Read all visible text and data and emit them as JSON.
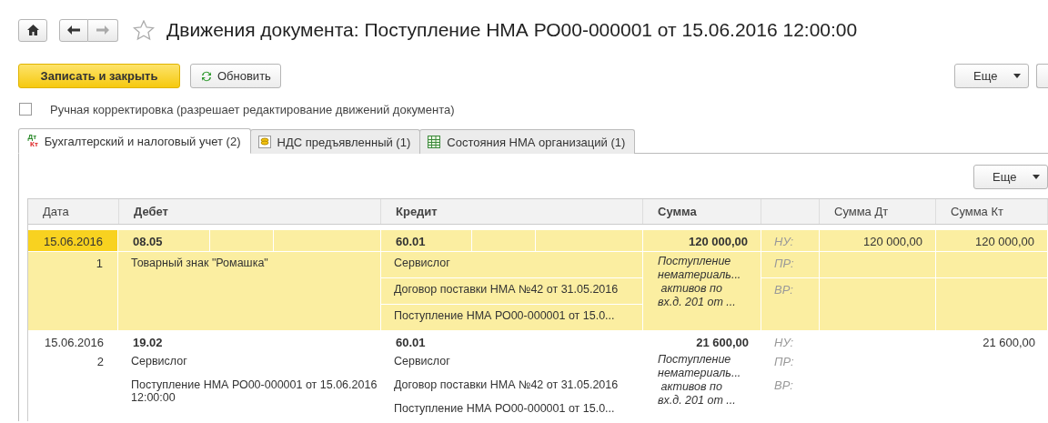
{
  "window": {
    "title": "Движения документа: Поступление НМА РО00-000001 от 15.06.2016 12:00:00",
    "favorite": false,
    "forward_disabled": true
  },
  "toolbar": {
    "primary": "Записать и закрыть",
    "refresh": "Обновить",
    "more": "Еще"
  },
  "manual_edit": {
    "label": "Ручная корректировка (разрешает редактирование движений документа)",
    "checked": false
  },
  "tabs": [
    {
      "kind": "dtkt",
      "icon_text": [
        "Дт",
        "Кт"
      ],
      "label": "Бухгалтерский и налоговый учет (2)",
      "selected": true
    },
    {
      "kind": "coins",
      "label": "НДС предъявленный (1)",
      "selected": false
    },
    {
      "kind": "table",
      "label": "Состояния НМА организаций (1)",
      "selected": false
    }
  ],
  "panel_more": "Еще",
  "table": {
    "columns": [
      "Дата",
      "Дебет",
      "Кредит",
      "Сумма",
      "Сумма Дт",
      "Сумма Кт"
    ],
    "rows": [
      {
        "selected": true,
        "date": "15.06.2016",
        "number": "1",
        "debit": {
          "account": "08.05",
          "subconto": [
            "Товарный знак \"Ромашка\""
          ]
        },
        "credit": {
          "account": "60.01",
          "subconto": [
            "Сервислог",
            "Договор поставки НМА №42 от 31.05.2016",
            "Поступление НМА РО00-000001 от 15.0..."
          ]
        },
        "amount": "120 000,00",
        "content": "Поступление\nнематериаль...\n активов по\nвх.д. 201 от ...",
        "labels": [
          "НУ:",
          "ПР:",
          "ВР:"
        ],
        "sum_dt": "120 000,00",
        "sum_kt": "120 000,00"
      },
      {
        "selected": false,
        "date": "15.06.2016",
        "number": "2",
        "debit": {
          "account": "19.02",
          "subconto": [
            "Сервислог",
            "Поступление НМА РО00-000001 от 15.06.2016 12:00:00"
          ]
        },
        "credit": {
          "account": "60.01",
          "subconto": [
            "Сервислог",
            "Договор поставки НМА №42 от 31.05.2016",
            "Поступление НМА РО00-000001 от 15.0..."
          ]
        },
        "amount": "21 600,00",
        "content": "Поступление\nнематериаль...\n активов по\nвх.д. 201 от ...",
        "labels": [
          "НУ:",
          "ПР:",
          "ВР:"
        ],
        "sum_kt": "21 600,00"
      }
    ]
  }
}
